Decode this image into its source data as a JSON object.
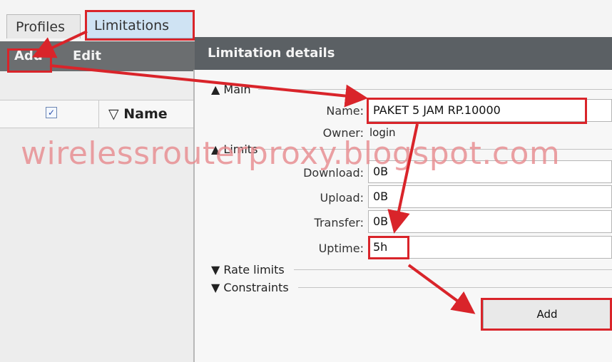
{
  "tabs": [
    {
      "label": "Profiles"
    },
    {
      "label": "Limitations"
    }
  ],
  "toolbar": {
    "add_label": "Add",
    "edit_label": "Edit"
  },
  "table": {
    "name_header": "Name",
    "sort_icon": "▽",
    "checkbox_checked": "✓"
  },
  "details": {
    "title": "Limitation details",
    "sections": {
      "main": "Main",
      "limits": "Limits",
      "rate_limits": "Rate limits",
      "constraints": "Constraints"
    },
    "fields": {
      "name": {
        "label": "Name:",
        "value": "PAKET 5 JAM RP.10000"
      },
      "owner": {
        "label": "Owner:",
        "value": "login"
      },
      "download": {
        "label": "Download:",
        "value": "0B"
      },
      "upload": {
        "label": "Upload:",
        "value": "0B"
      },
      "transfer": {
        "label": "Transfer:",
        "value": "0B"
      },
      "uptime": {
        "label": "Uptime:",
        "value": "5h"
      }
    },
    "add_button": "Add"
  },
  "watermark": "wirelessrouterproxy.blogspot.com",
  "colors": {
    "annotation_red": "#d9242a",
    "active_tab": "#cfe3f3",
    "header_bar": "#5b6064"
  }
}
